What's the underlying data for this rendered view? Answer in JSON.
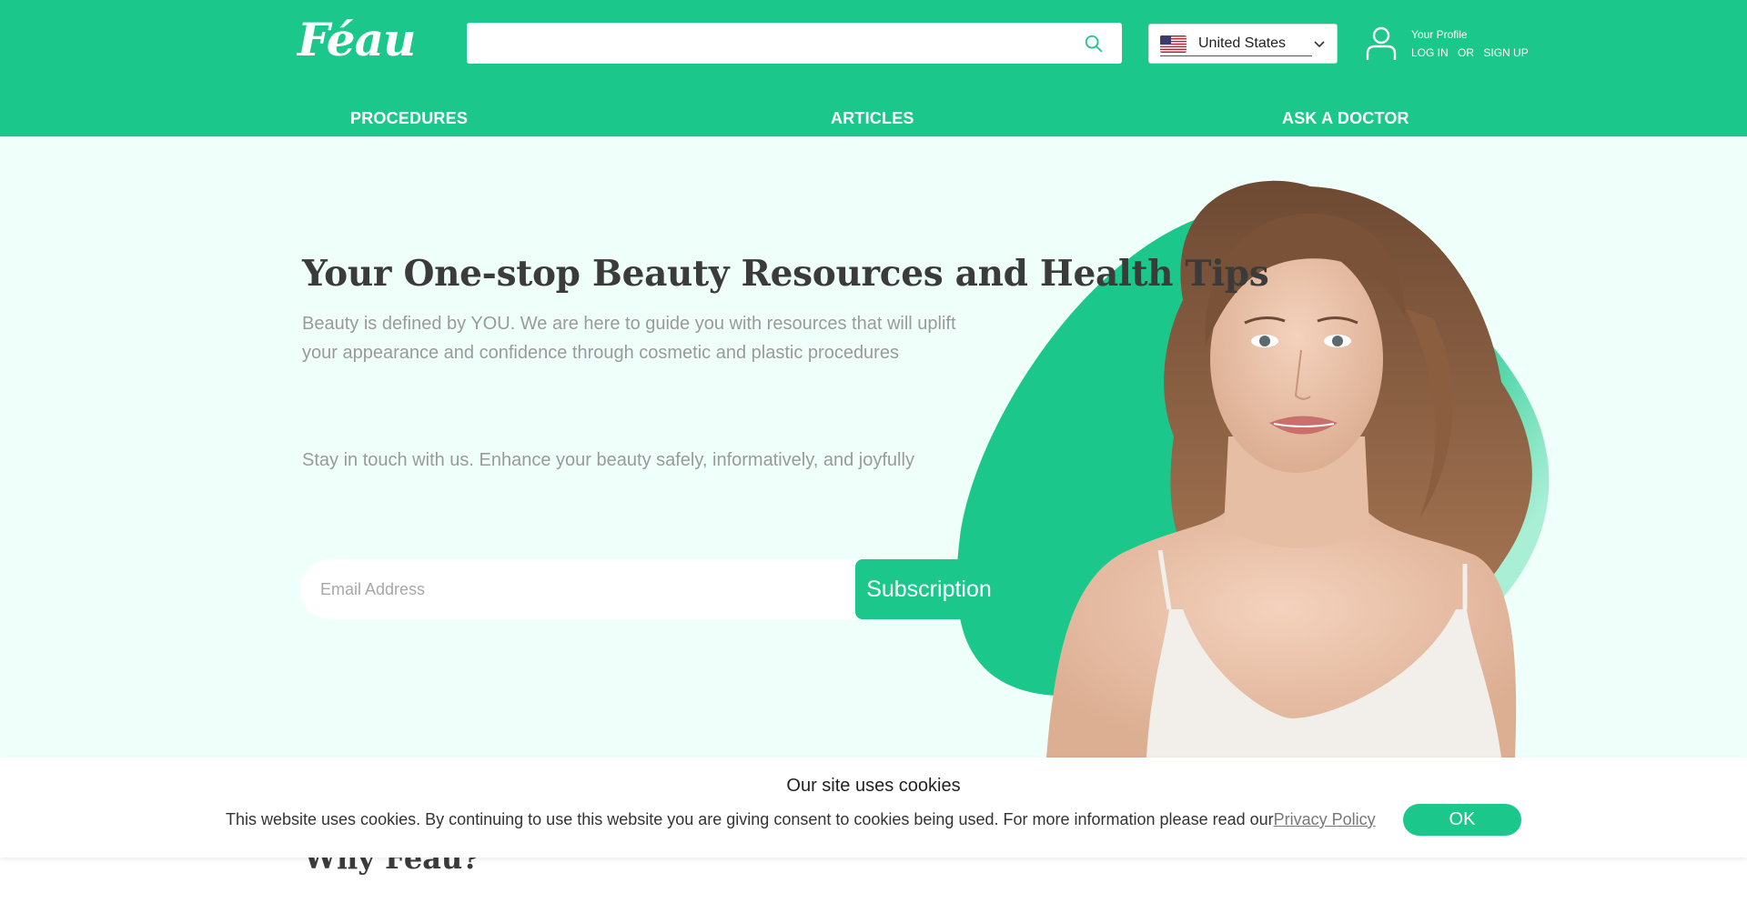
{
  "header": {
    "logo_text": "Féau",
    "search": {
      "placeholder": "",
      "value": ""
    },
    "country": {
      "label": "United States",
      "flag": "us-flag-icon"
    },
    "profile": {
      "title": "Your Profile",
      "login": "LOG IN",
      "or": "OR",
      "signup": "SIGN UP"
    },
    "nav": [
      "PROCEDURES",
      "ARTICLES",
      "ASK A DOCTOR"
    ]
  },
  "hero": {
    "title": "Your One-stop Beauty Resources and Health Tips",
    "subtitle": "Beauty is defined by YOU. We are here to guide you with resources that will uplift your appearance and confidence through cosmetic and plastic procedures",
    "touch": "Stay in touch with us. Enhance your beauty safely, informatively, and joyfully",
    "email_placeholder": "Email Address",
    "subscribe_label": "Subscription"
  },
  "section_heading": "Why Féau?",
  "cookie": {
    "title": "Our site uses cookies",
    "text": "This website uses cookies. By continuing to use this website you are giving consent to cookies being used. For more information please read our",
    "link": "Privacy Policy",
    "ok_label": "OK"
  },
  "colors": {
    "brand_green": "#1cc78c",
    "hero_background": "#effff9",
    "heading_text": "#3b3b3b"
  }
}
